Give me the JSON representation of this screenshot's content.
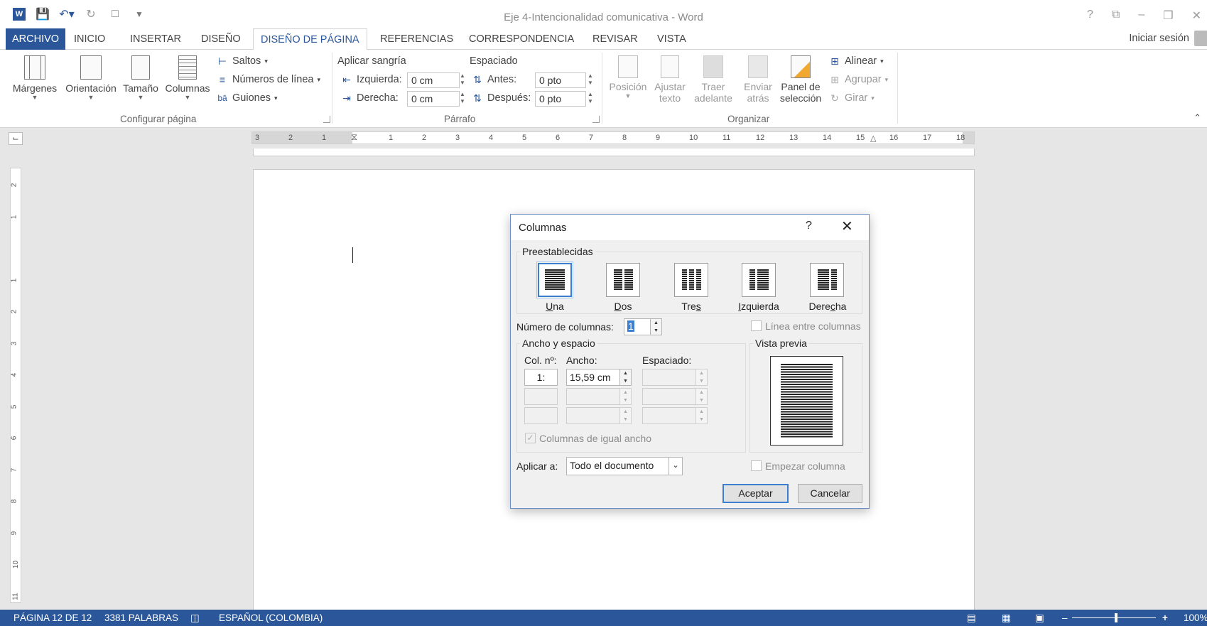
{
  "window": {
    "title": "Eje 4-Intencionalidad comunicativa - Word",
    "controls": [
      "?",
      "⧉",
      "–",
      "❐",
      "✕"
    ]
  },
  "tabs": [
    "ARCHIVO",
    "INICIO",
    "INSERTAR",
    "DISEÑO",
    "DISEÑO DE PÁGINA",
    "REFERENCIAS",
    "CORRESPONDENCIA",
    "REVISAR",
    "VISTA"
  ],
  "active_tab": "DISEÑO DE PÁGINA",
  "signin": "Iniciar sesión",
  "ribbon": {
    "configurar": {
      "margenes": "Márgenes",
      "orientacion": "Orientación",
      "tamano": "Tamaño",
      "columnas": "Columnas",
      "saltos": "Saltos",
      "numeros_linea": "Números de línea",
      "guiones": "Guiones",
      "label": "Configurar página"
    },
    "parrafo": {
      "aplicar_sangria": "Aplicar sangría",
      "izquierda_label": "Izquierda:",
      "izquierda_value": "0 cm",
      "derecha_label": "Derecha:",
      "derecha_value": "0 cm",
      "espaciado": "Espaciado",
      "antes_label": "Antes:",
      "antes_value": "0 pto",
      "despues_label": "Después:",
      "despues_value": "0 pto",
      "label": "Párrafo"
    },
    "organizar": {
      "posicion": "Posición",
      "ajustar": "Ajustar",
      "texto": "texto",
      "traer": "Traer",
      "adelante": "adelante",
      "enviar": "Enviar",
      "atras": "atrás",
      "panel_de": "Panel de",
      "seleccion": "selección",
      "alinear": "Alinear",
      "agrupar": "Agrupar",
      "girar": "Girar",
      "label": "Organizar"
    }
  },
  "ruler": {
    "marks": [
      "3",
      "2",
      "1",
      "1",
      "2",
      "3",
      "4",
      "5",
      "6",
      "7",
      "8",
      "9",
      "10",
      "11",
      "12",
      "13",
      "14",
      "15",
      "16",
      "17",
      "18"
    ],
    "vmarks": [
      "2",
      "1",
      "1",
      "2",
      "3",
      "4",
      "5",
      "6",
      "7",
      "8",
      "9",
      "10",
      "11"
    ]
  },
  "dialog": {
    "title": "Columnas",
    "help": "?",
    "close": "✕",
    "presets_legend": "Preestablecidas",
    "presets": [
      {
        "label": "Una",
        "key": "U",
        "rest": "na"
      },
      {
        "label": "Dos",
        "key": "D",
        "rest": "os"
      },
      {
        "label": "Tres",
        "pre": "Tre",
        "key": "s"
      },
      {
        "label": "Izquierda",
        "key": "I",
        "rest": "zquierda"
      },
      {
        "label": "Derecha",
        "pre": "Dere",
        "key": "c",
        "rest": "ha"
      }
    ],
    "num_cols_label": "Número de columnas:",
    "num_cols_value": "1",
    "linea_entre": "Línea entre columnas",
    "ancho_legend": "Ancho y espacio",
    "col_header": "Col. nº:",
    "ancho_header": "Ancho:",
    "espaciado_header": "Espaciado:",
    "rows": [
      {
        "col": "1:",
        "ancho": "15,59 cm",
        "espaciado": ""
      },
      {
        "col": "",
        "ancho": "",
        "espaciado": ""
      },
      {
        "col": "",
        "ancho": "",
        "espaciado": ""
      }
    ],
    "igual_ancho": "Columnas de igual ancho",
    "vista_previa": "Vista previa",
    "aplicar_label": "Aplicar a:",
    "aplicar_value": "Todo el documento",
    "empezar_columna": "Empezar columna",
    "aceptar": "Aceptar",
    "cancelar": "Cancelar"
  },
  "status": {
    "pagina": "PÁGINA 12 DE 12",
    "palabras": "3381 PALABRAS",
    "idioma": "ESPAÑOL (COLOMBIA)",
    "zoom": "100%"
  }
}
